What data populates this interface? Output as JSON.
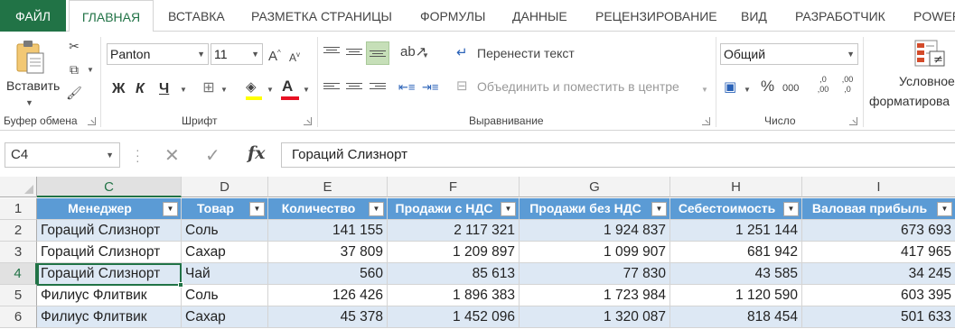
{
  "tabs": [
    "ФАЙЛ",
    "ГЛАВНАЯ",
    "ВСТАВКА",
    "РАЗМЕТКА СТРАНИЦЫ",
    "ФОРМУЛЫ",
    "ДАННЫЕ",
    "РЕЦЕНЗИРОВАНИЕ",
    "ВИД",
    "РАЗРАБОТЧИК",
    "POWER"
  ],
  "ribbon": {
    "clipboard": {
      "paste_label": "Вставить",
      "group_label": "Буфер обмена"
    },
    "font": {
      "font_name": "Panton",
      "font_size": "11",
      "bold": "Ж",
      "italic": "К",
      "underline": "Ч",
      "grow": "A",
      "shrink": "A",
      "group_label": "Шрифт"
    },
    "alignment": {
      "wrap_text": "Перенести текст",
      "merge_center": "Объединить и поместить в центре",
      "group_label": "Выравнивание"
    },
    "number": {
      "format": "Общий",
      "percent": "%",
      "thousands": "000",
      "inc_decimal": ",0 ,00",
      "dec_decimal": ",00 ,0",
      "group_label": "Число"
    },
    "styles": {
      "conditional_line1": "Условное",
      "conditional_line2": "форматирова"
    }
  },
  "formula_bar": {
    "name_box": "C4",
    "fx": "fx",
    "content": "Гораций Слизнорт"
  },
  "grid": {
    "columns": [
      "C",
      "D",
      "E",
      "F",
      "G",
      "H",
      "I"
    ],
    "active_column": "C",
    "rows": [
      "1",
      "2",
      "3",
      "4",
      "5",
      "6"
    ],
    "active_row": "4",
    "headers": [
      "Менеджер",
      "Товар",
      "Количество",
      "Продажи с НДС",
      "Продажи без НДС",
      "Себестоимость",
      "Валовая прибыль"
    ],
    "data": [
      [
        "Гораций Слизнорт",
        "Соль",
        "141 155",
        "2 117 321",
        "1 924 837",
        "1 251 144",
        "673 693"
      ],
      [
        "Гораций Слизнорт",
        "Сахар",
        "37 809",
        "1 209 897",
        "1 099 907",
        "681 942",
        "417 965"
      ],
      [
        "Гораций Слизнорт",
        "Чай",
        "560",
        "85 613",
        "77 830",
        "43 585",
        "34 245"
      ],
      [
        "Филиус Флитвик",
        "Соль",
        "126 426",
        "1 896 383",
        "1 723 984",
        "1 120 590",
        "603 395"
      ],
      [
        "Филиус Флитвик",
        "Сахар",
        "45 378",
        "1 452 096",
        "1 320 087",
        "818 454",
        "501 633"
      ]
    ]
  },
  "colors": {
    "excel_green": "#217346",
    "table_header": "#5b9bd5",
    "table_band": "#dde8f4",
    "font_color": "#e81123",
    "highlight": "#ffff00"
  }
}
